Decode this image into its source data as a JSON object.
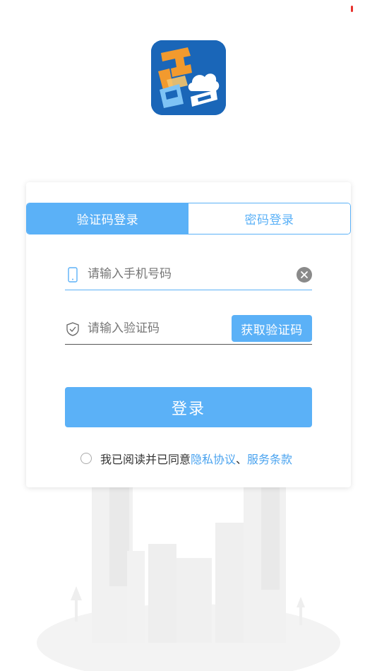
{
  "status_bar": {
    "indicator_color": "#e8322d"
  },
  "app": {
    "logo_icon": "app-logo-icon",
    "brand_color": "#1a66b8"
  },
  "login": {
    "tabs": [
      {
        "label": "验证码登录",
        "active": true
      },
      {
        "label": "密码登录",
        "active": false
      }
    ],
    "phone": {
      "placeholder": "请输入手机号码",
      "value": "",
      "icon": "phone-icon",
      "clear_icon": "clear-icon"
    },
    "code": {
      "placeholder": "请输入验证码",
      "value": "",
      "icon": "shield-icon"
    },
    "get_code_label": "获取验证码",
    "submit_label": "登录",
    "agreement": {
      "checked": false,
      "prefix": "我已阅读并已同意",
      "privacy_link": "隐私协议",
      "separator": "、",
      "terms_link": "服务条款"
    }
  },
  "colors": {
    "accent": "#5bb1f7",
    "link": "#4aa3ef",
    "text": "#333333",
    "placeholder": "#777777"
  }
}
